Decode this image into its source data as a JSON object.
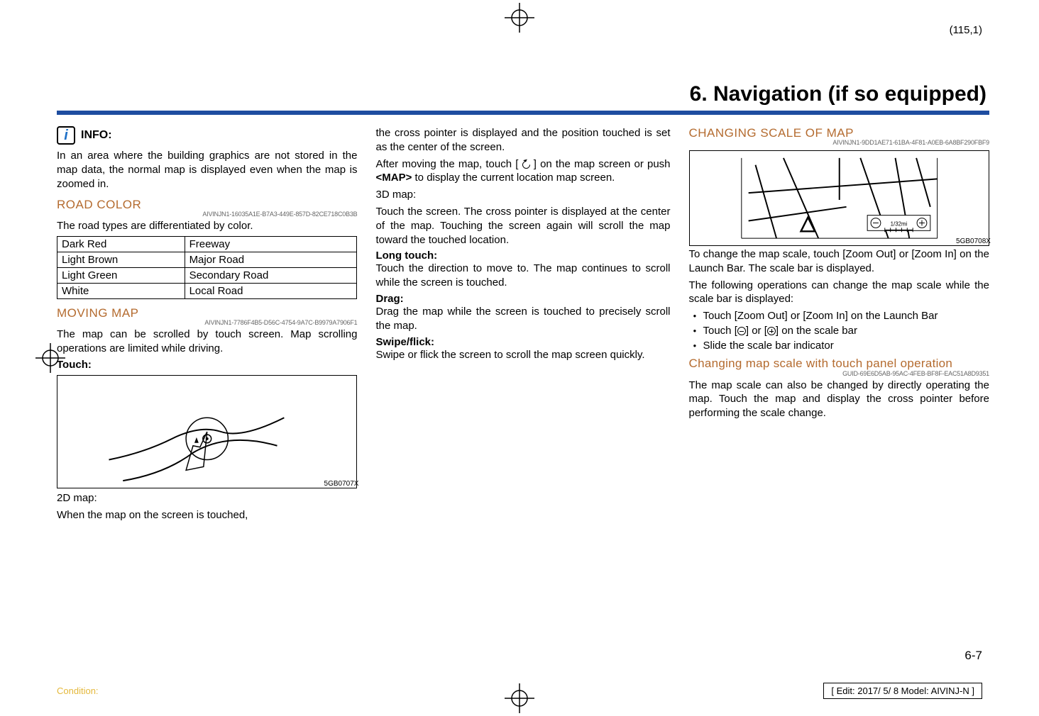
{
  "page_coord": "(115,1)",
  "chapter_title": "6. Navigation (if so equipped)",
  "col1": {
    "info_label": "INFO:",
    "info_body": "In an area where the building graphics are not stored in the map data, the normal map is displayed even when the map is zoomed in.",
    "road_color_head": "ROAD COLOR",
    "road_color_guid": "AIVINJN1-16035A1E-B7A3-449E-857D-82CE718C0B3B",
    "road_color_body": "The road types are differentiated by color.",
    "road_table": [
      [
        "Dark Red",
        "Freeway"
      ],
      [
        "Light Brown",
        "Major Road"
      ],
      [
        "Light Green",
        "Secondary Road"
      ],
      [
        "White",
        "Local Road"
      ]
    ],
    "moving_map_head": "MOVING MAP",
    "moving_map_guid": "AIVINJN1-7786F4B5-D56C-4754-9A7C-B9979A7906F1",
    "moving_map_body": "The map can be scrolled by touch screen. Map scrolling operations are limited while driving.",
    "touch_head": "Touch:",
    "illus_code": "5GB0707X",
    "p2_a": "2D map:",
    "p2_b": "When the map on the screen is touched,"
  },
  "col2": {
    "p1": "the cross pointer is displayed and the position touched is set as the center of the screen.",
    "p2a": "After moving the map, touch [",
    "p2b": "] on the map screen or push ",
    "map_btn": "<MAP>",
    "p2c": " to display the current location map screen.",
    "p3": "3D map:",
    "p4": "Touch the screen. The cross pointer is displayed at the center of the map. Touching the screen again will scroll the map toward the touched location.",
    "long_touch": "Long touch:",
    "p5": "Touch the direction to move to. The map continues to scroll while the screen is touched.",
    "drag": "Drag:",
    "p6": "Drag the map while the screen is touched to precisely scroll the map.",
    "swipe": "Swipe/flick:",
    "p7": "Swipe or flick the screen to scroll the map screen quickly."
  },
  "col3": {
    "scale_head": "CHANGING SCALE OF MAP",
    "scale_guid": "AIVINJN1-9DD1AE71-61BA-4F81-A0EB-6A8BF290FBF9",
    "illus_code": "5GB0708X",
    "p1": "To change the map scale, touch [Zoom Out] or [Zoom In] on the Launch Bar. The scale bar is displayed.",
    "p2": "The following operations can change the map scale while the scale bar is displayed:",
    "bullets": [
      "Touch [Zoom Out] or [Zoom In] on the Launch Bar",
      "Touch [   ] or [   ] on the scale bar",
      "Slide the scale bar indicator"
    ],
    "sub_head": "Changing map scale with touch panel operation",
    "sub_guid": "GUID-69E6D5AB-95AC-4FEB-BF8F-EAC51A8D9351",
    "p3": "The map scale can also be changed by directly operating the map. Touch the map and display the cross pointer before performing the scale change."
  },
  "page_num": "6-7",
  "condition": "Condition:",
  "edit_box": "[ Edit: 2017/ 5/ 8    Model:  AIVINJ-N ]"
}
